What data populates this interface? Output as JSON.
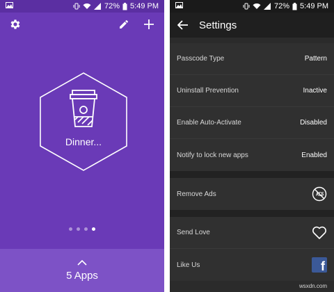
{
  "status_bar": {
    "battery": "72%",
    "time": "5:49 PM"
  },
  "left": {
    "app_name": "Dinner...",
    "pager": {
      "count": 4,
      "active_index": 3
    },
    "apps_label": "5 Apps",
    "colors": {
      "background": "#6a3ab7",
      "bottom_bar": "#7d52c6"
    }
  },
  "right": {
    "title": "Settings",
    "groups": [
      [
        {
          "label": "Passcode Type",
          "value": "Pattern"
        },
        {
          "label": "Uninstall Prevention",
          "value": "Inactive"
        },
        {
          "label": "Enable Auto-Activate",
          "value": "Disabled"
        },
        {
          "label": "Notify to lock new apps",
          "value": "Enabled"
        }
      ],
      [
        {
          "label": "Remove Ads",
          "icon": "no-ads-icon"
        }
      ],
      [
        {
          "label": "Send Love",
          "icon": "heart-outline-icon"
        },
        {
          "label": "Like Us",
          "icon": "facebook-icon",
          "icon_letter": "f"
        }
      ]
    ],
    "watermark": "wsxdn.com",
    "colors": {
      "background": "#2b2b2b",
      "appbar": "#1f1f1f",
      "facebook": "#3b5998"
    }
  }
}
